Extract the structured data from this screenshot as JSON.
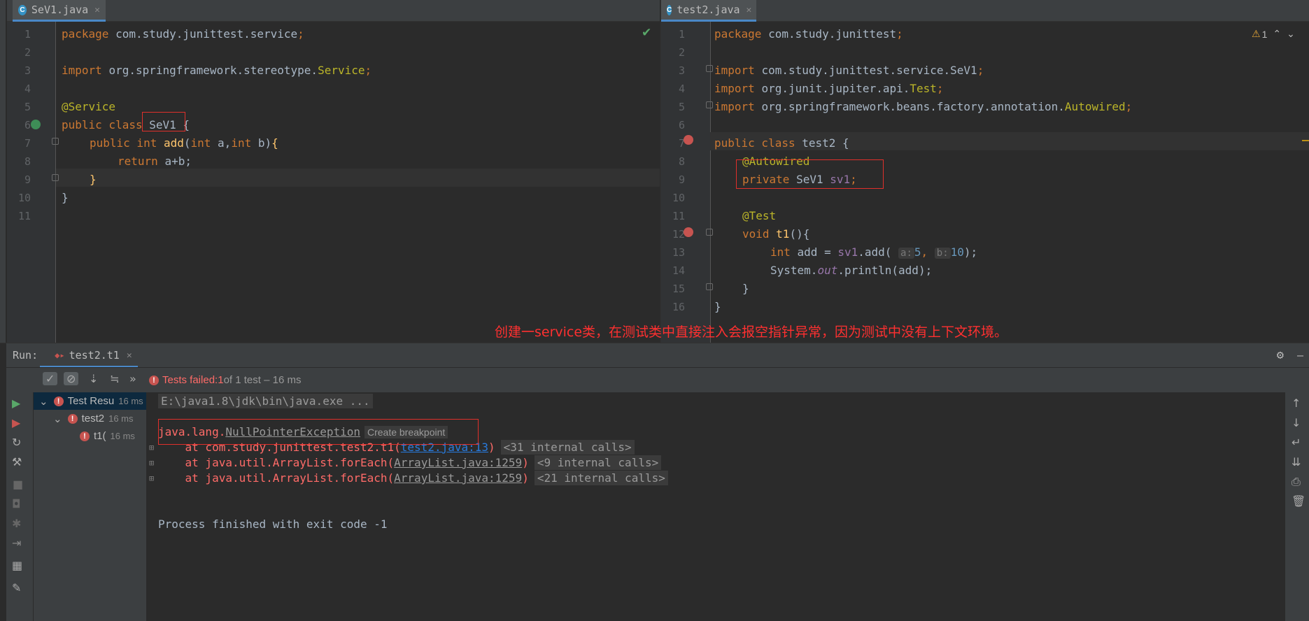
{
  "left_tab": {
    "label": "SeV1.java",
    "icon": "C"
  },
  "right_tab": {
    "label": "test2.java",
    "icon": "C"
  },
  "warning_count": "1",
  "note": "创建一service类，在测试类中直接注入会报空指针异常，因为测试中没有上下文环境。",
  "left_lines": [
    "1",
    "2",
    "3",
    "4",
    "5",
    "6",
    "7",
    "8",
    "9",
    "10",
    "11"
  ],
  "right_lines": [
    "1",
    "2",
    "3",
    "4",
    "5",
    "6",
    "7",
    "8",
    "9",
    "10",
    "11",
    "12",
    "13",
    "14",
    "15",
    "16"
  ],
  "left_code": {
    "l1": [
      "package ",
      "com.study.junittest.service",
      ";"
    ],
    "l3": [
      "import ",
      "org.springframework.stereotype.",
      "Service",
      ";"
    ],
    "l5": "@Service",
    "l6": [
      "public class ",
      "SeV1",
      " {"
    ],
    "l7": [
      "public int ",
      "add",
      "(",
      "int ",
      "a,",
      "int ",
      "b)",
      "{"
    ],
    "l8": [
      "return ",
      "a+b;"
    ],
    "l9": "}",
    "l10": "}"
  },
  "right_code": {
    "l1": [
      "package ",
      "com.study.junittest",
      ";"
    ],
    "l3": [
      "import ",
      "com.study.junittest.service.SeV1",
      ";"
    ],
    "l4": [
      "import ",
      "org.junit.jupiter.api.",
      "Test",
      ";"
    ],
    "l5": [
      "import ",
      "org.springframework.beans.factory.annotation.",
      "Autowired",
      ";"
    ],
    "l7": [
      "public class ",
      "test2",
      " {"
    ],
    "l8": "@Autowired",
    "l9": [
      "private ",
      "SeV1 ",
      "sv1",
      ";"
    ],
    "l11": "@Test",
    "l12": [
      "void ",
      "t1",
      "(){"
    ],
    "l13": [
      "int ",
      "add = ",
      "sv1",
      ".add( ",
      "a:",
      "5",
      ", ",
      "b:",
      "10",
      ");"
    ],
    "l14": [
      "System.",
      "out",
      ".println(add);"
    ],
    "l15": "}",
    "l16": "}"
  },
  "run": {
    "label": "Run:",
    "tab": "test2.t1",
    "status_prefix": "Tests failed: ",
    "status_count": "1",
    "status_suffix": " of 1 test – 16 ms",
    "tree": [
      {
        "name": "Test Resu",
        "time": "16 ms"
      },
      {
        "name": "test2",
        "time": "16 ms"
      },
      {
        "name": "t1(",
        "time": "16 ms"
      }
    ],
    "console": {
      "cmd": "E:\\java1.8\\jdk\\bin\\java.exe ...",
      "exc_prefix": "java.lang.",
      "exc_name": "NullPointerException",
      "breakpoint": "Create breakpoint",
      "frames": [
        {
          "at": "    at com.study.junittest.test2.t1(",
          "link": "test2.java:13",
          "close": ")",
          "internal": "<31 internal calls>"
        },
        {
          "at": "    at java.util.ArrayList.forEach(",
          "link": "ArrayList.java:1259",
          "close": ")",
          "internal": "<9 internal calls>"
        },
        {
          "at": "    at java.util.ArrayList.forEach(",
          "link": "ArrayList.java:1259",
          "close": ")",
          "internal": "<21 internal calls>"
        }
      ],
      "exit": "Process finished with exit code -1"
    }
  }
}
